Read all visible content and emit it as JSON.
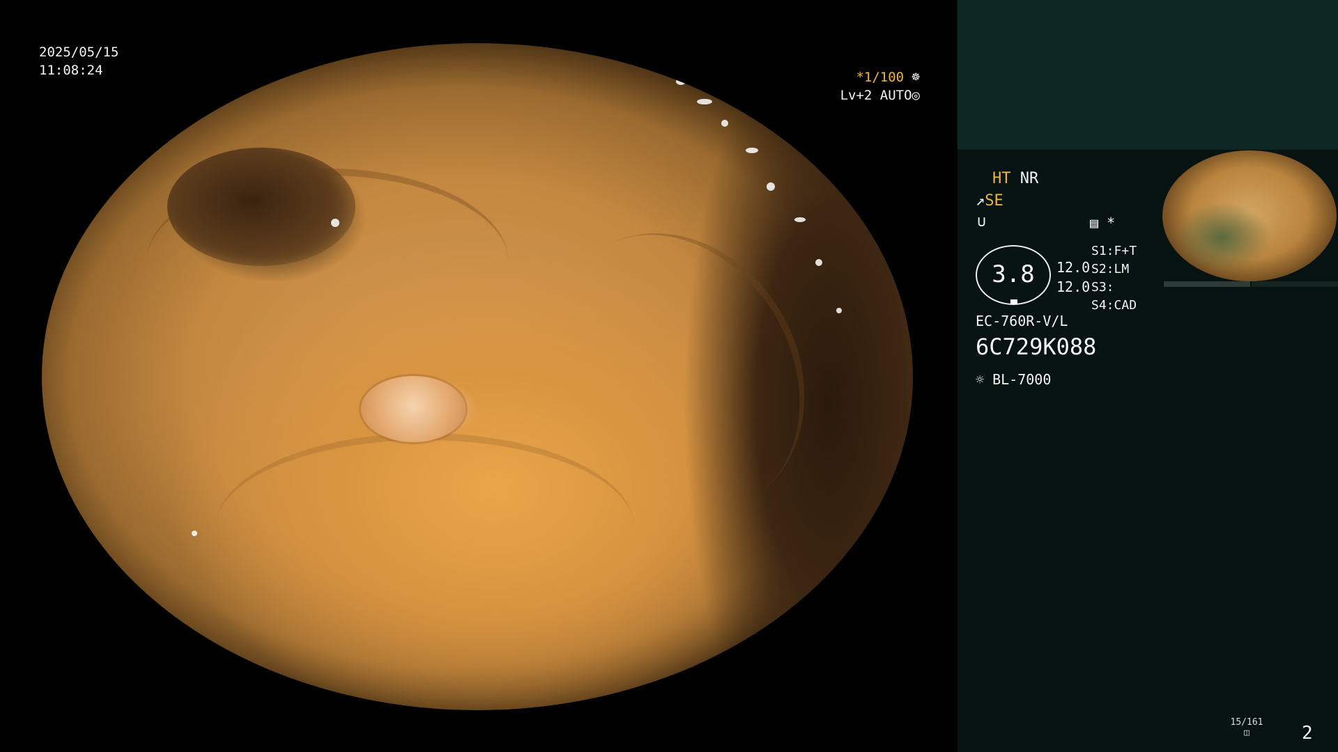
{
  "datetime": {
    "date": "2025/05/15",
    "time": "11:08:24"
  },
  "video": {
    "shutter": "*1/100",
    "level": "Lv+2",
    "mode": "AUTO"
  },
  "panel": {
    "ht": "HT",
    "nr": "NR",
    "se": "SE",
    "star": "*",
    "ring_value": "3.8",
    "side_values": [
      "12.0",
      "12.0"
    ],
    "switches": [
      {
        "key": "S1:",
        "value": "F+T"
      },
      {
        "key": "S2:",
        "value": "LM"
      },
      {
        "key": "S3:",
        "value": ""
      },
      {
        "key": "S4:",
        "value": "CAD"
      }
    ],
    "scope_model": "EC-760R-V/L",
    "serial": "6C729K088",
    "light_source": "BL-7000",
    "storage_count": "15/161",
    "page_number": "2"
  },
  "colors": {
    "highlight": "#f0b43a",
    "panel_top": "#0e2624",
    "panel_bottom": "#061310"
  }
}
